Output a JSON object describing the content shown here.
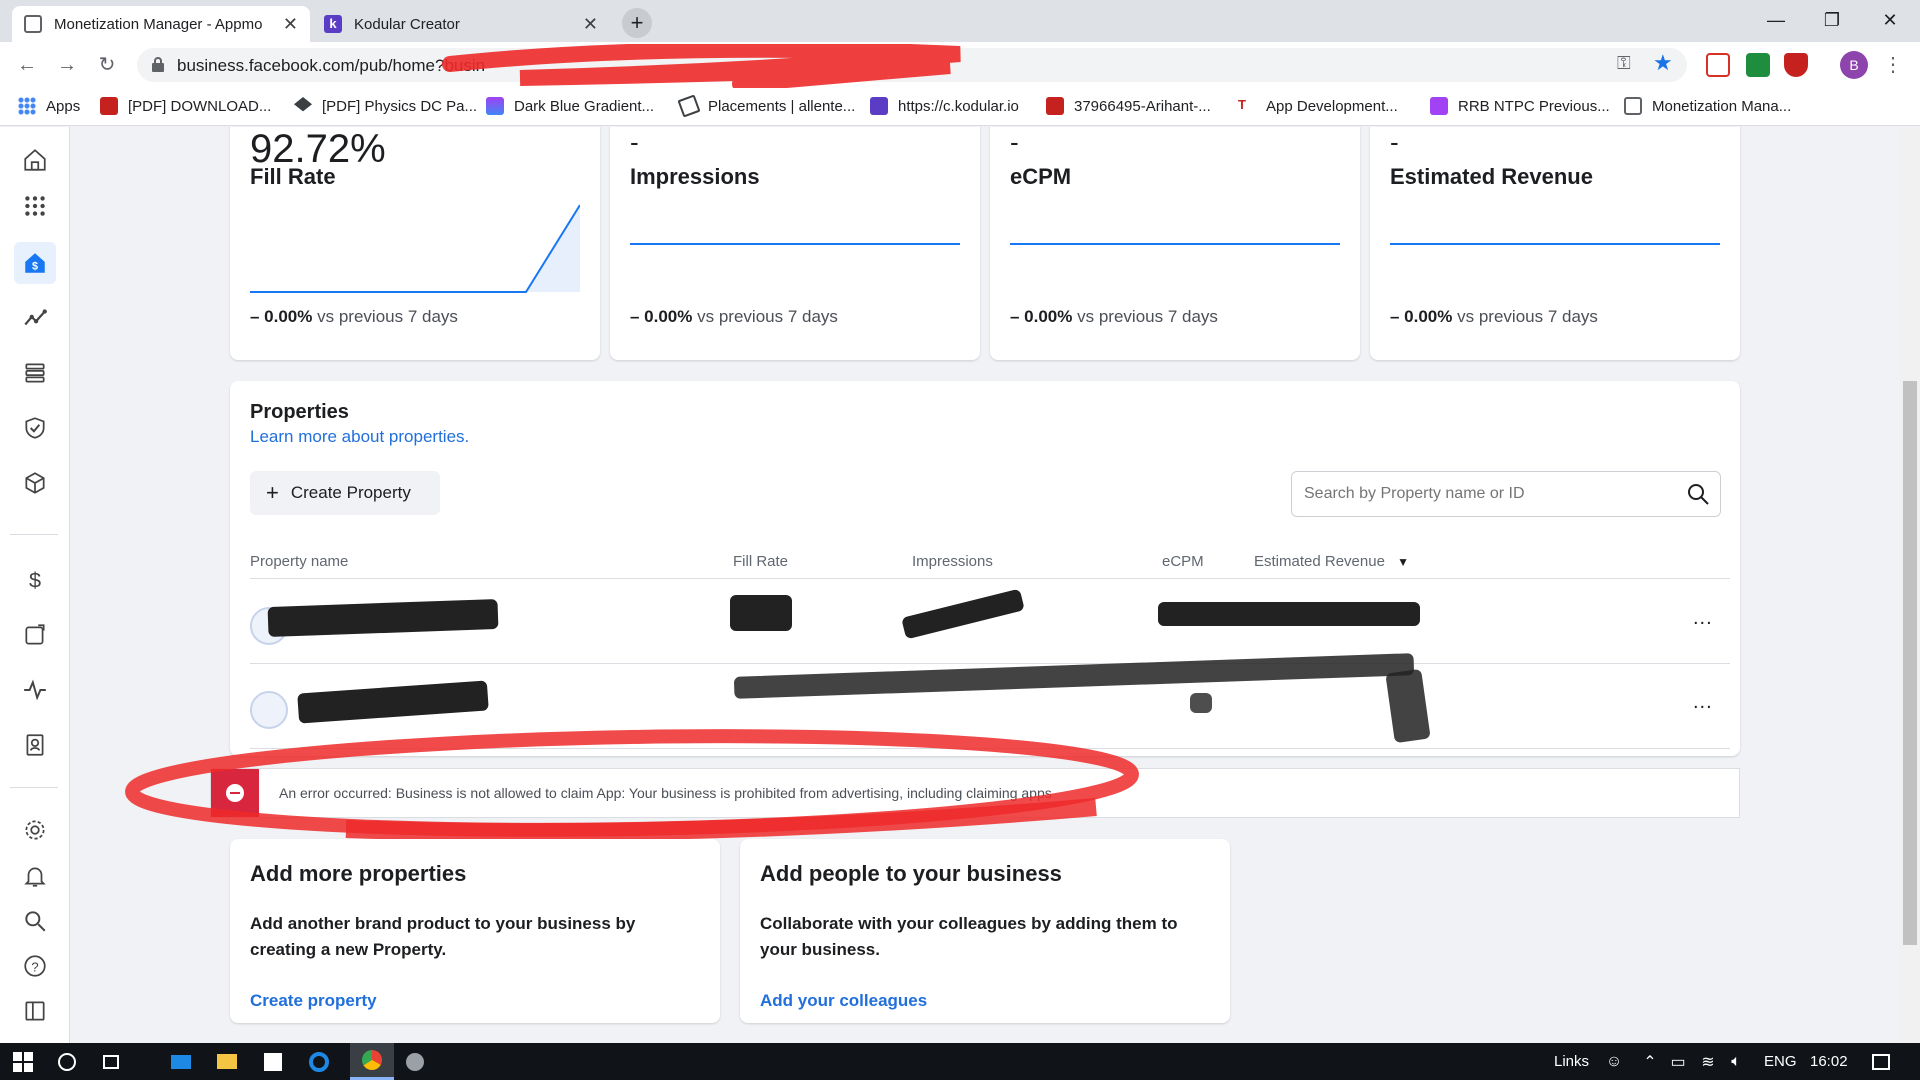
{
  "browser": {
    "tabs": [
      {
        "title": "Monetization Manager - Appmo",
        "active": true
      },
      {
        "title": "Kodular Creator",
        "active": false
      }
    ],
    "url": "business.facebook.com/pub/home?busin",
    "profile_initial": "B",
    "bookmarks": [
      {
        "label": "Apps",
        "icon": "apps-grid-icon"
      },
      {
        "label": "[PDF] DOWNLOAD...",
        "icon": "pdf-icon"
      },
      {
        "label": "[PDF] Physics DC Pa...",
        "icon": "graduation-cap-icon"
      },
      {
        "label": "Dark Blue Gradient...",
        "icon": "gradient-icon"
      },
      {
        "label": "Placements | allente...",
        "icon": "send-icon"
      },
      {
        "label": "https://c.kodular.io",
        "icon": "kodular-icon"
      },
      {
        "label": "37966495-Arihant-...",
        "icon": "pdf-icon"
      },
      {
        "label": "App Development...",
        "icon": "ts-icon"
      },
      {
        "label": "RRB NTPC Previous...",
        "icon": "sp-icon"
      },
      {
        "label": "Monetization Mana...",
        "icon": "page-icon"
      }
    ]
  },
  "metrics": [
    {
      "value": "92.72%",
      "label": "Fill Rate",
      "change": "– 0.00%",
      "compare": "vs previous 7 days",
      "has_value": true
    },
    {
      "value": "-",
      "label": "Impressions",
      "change": "– 0.00%",
      "compare": "vs previous 7 days",
      "has_value": false
    },
    {
      "value": "-",
      "label": "eCPM",
      "change": "– 0.00%",
      "compare": "vs previous 7 days",
      "has_value": false
    },
    {
      "value": "-",
      "label": "Estimated Revenue",
      "change": "– 0.00%",
      "compare": "vs previous 7 days",
      "has_value": false
    }
  ],
  "properties": {
    "title": "Properties",
    "learn_more": "Learn more about properties.",
    "create_label": "Create Property",
    "search_placeholder": "Search by Property name or ID",
    "columns": [
      "Property name",
      "Fill Rate",
      "Impressions",
      "eCPM",
      "Estimated Revenue"
    ],
    "rows": [
      {
        "row_actions": "..."
      },
      {
        "row_actions": "..."
      }
    ]
  },
  "error": {
    "message": "An error occurred: Business is not allowed to claim App: Your business is prohibited from advertising, including claiming apps"
  },
  "promos": [
    {
      "title": "Add more properties",
      "description": "Add another brand product to your business by creating a new Property.",
      "link": "Create property"
    },
    {
      "title": "Add people to your business",
      "description": "Collaborate with your colleagues by adding them to your business.",
      "link": "Add your colleagues"
    }
  ],
  "taskbar": {
    "links_label": "Links",
    "language": "ENG",
    "time": "16:02"
  },
  "colors": {
    "accent": "#1877f2",
    "link": "#216fdb",
    "error": "#d7263d",
    "annotation": "#ee2a2a"
  }
}
